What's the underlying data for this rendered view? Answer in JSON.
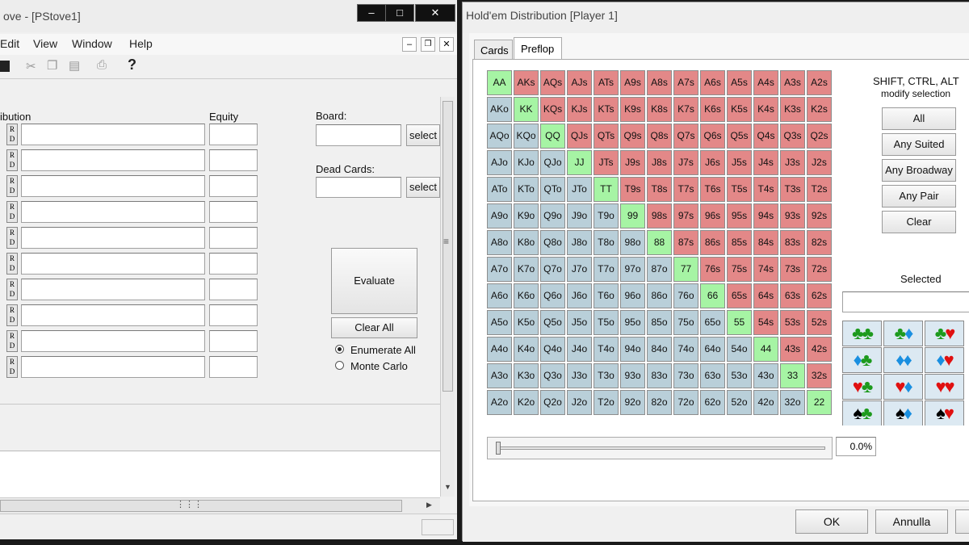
{
  "left_window": {
    "title": "ove - [PStove1]",
    "menu": [
      "Edit",
      "View",
      "Window",
      "Help"
    ],
    "col_distribution": "ibution",
    "col_equity": "Equity",
    "board_label": "Board:",
    "dead_cards_label": "Dead Cards:",
    "select_label": "select",
    "evaluate_label": "Evaluate",
    "clear_all_label": "Clear All",
    "enumerate_all_label": "Enumerate All",
    "monte_carlo_label": "Monte Carlo",
    "rd_top": "R",
    "rd_bottom": "D"
  },
  "dialog": {
    "title": "Hold'em Distribution [Player 1]",
    "tabs": [
      "Cards",
      "Preflop"
    ],
    "hint_line1": "SHIFT, CTRL, ALT",
    "hint_line2": "modify selection",
    "buttons": [
      "All",
      "Any Suited",
      "Any Broadway",
      "Any Pair",
      "Clear"
    ],
    "selected_label": "Selected",
    "slider_value": "0.0%",
    "ok_label": "OK",
    "cancel_label": "Annulla",
    "ranks": [
      "A",
      "K",
      "Q",
      "J",
      "T",
      "9",
      "8",
      "7",
      "6",
      "5",
      "4",
      "3",
      "2"
    ],
    "suit_pairs": [
      [
        [
          "c",
          "c"
        ],
        [
          "c",
          "d"
        ],
        [
          "c",
          "h"
        ]
      ],
      [
        [
          "d",
          "c"
        ],
        [
          "d",
          "d"
        ],
        [
          "d",
          "h"
        ]
      ],
      [
        [
          "h",
          "c"
        ],
        [
          "h",
          "d"
        ],
        [
          "h",
          "h"
        ]
      ],
      [
        [
          "s",
          "c"
        ],
        [
          "s",
          "d"
        ],
        [
          "s",
          "h"
        ]
      ]
    ],
    "colors": {
      "pair": "#a6f4a4",
      "suited": "#e38888",
      "offsuit": "#b9cfd9"
    }
  }
}
